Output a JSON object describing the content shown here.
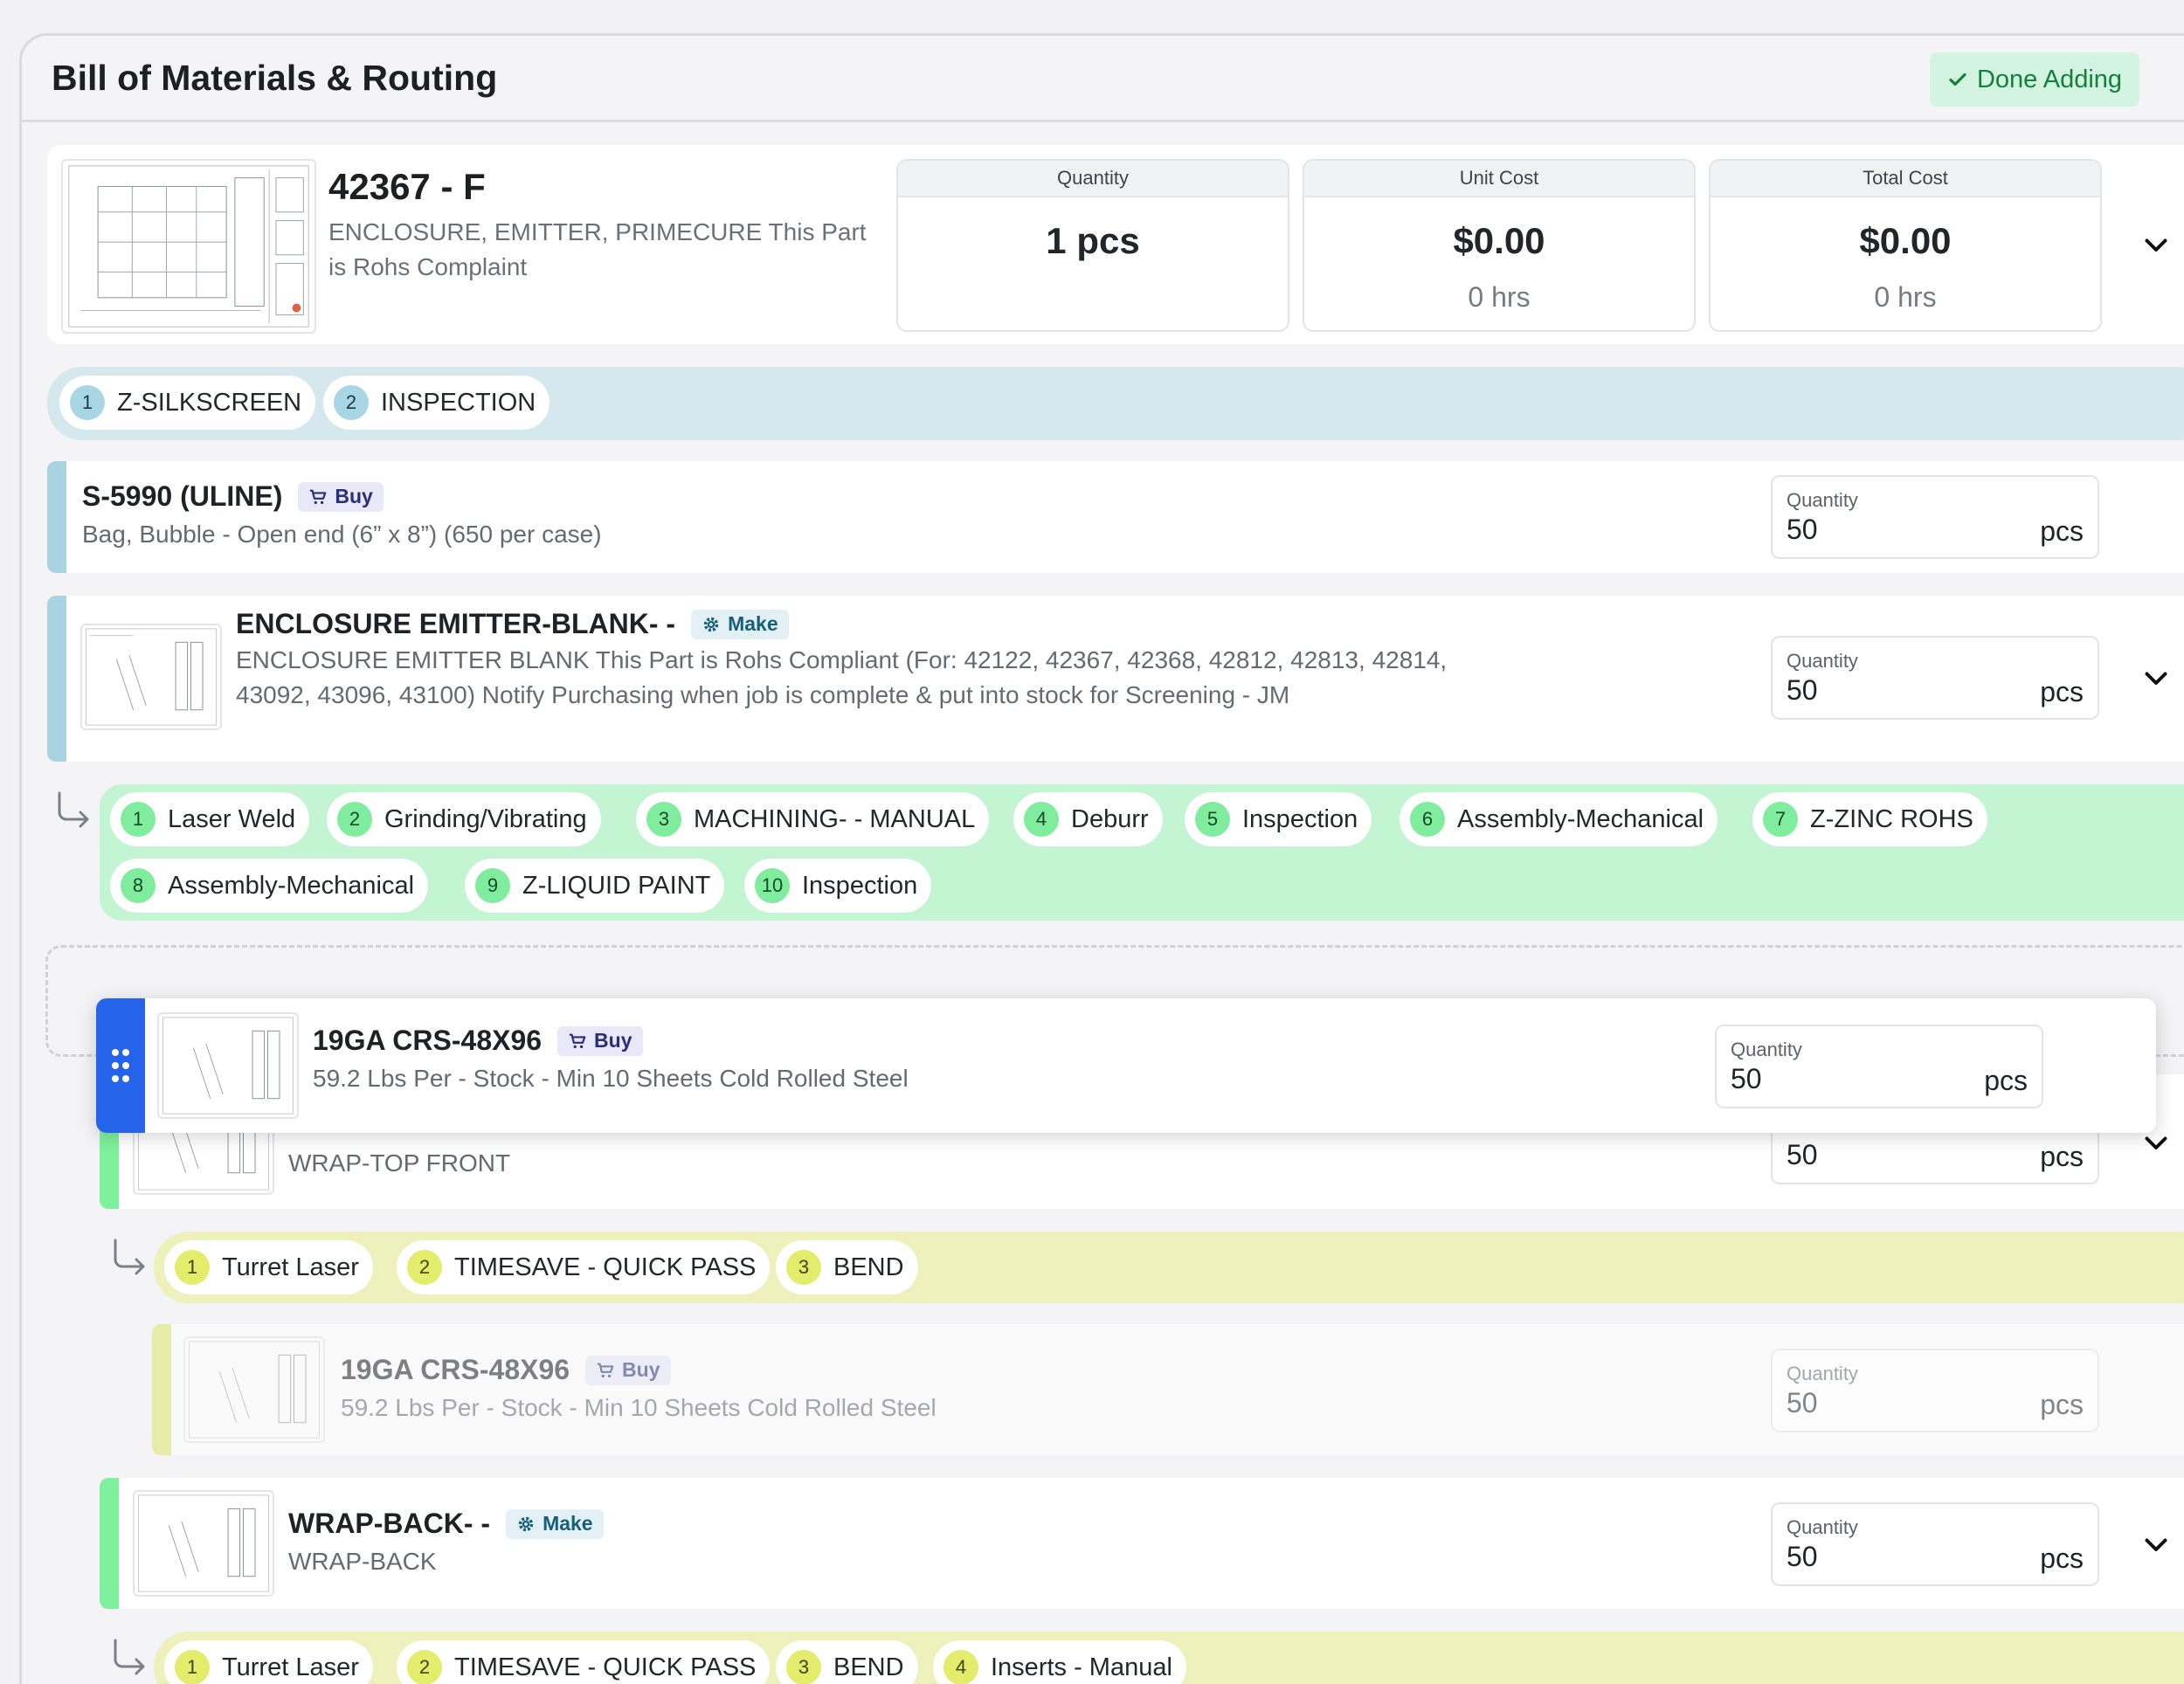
{
  "header": {
    "title": "Bill of Materials & Routing",
    "done_label": "Done Adding"
  },
  "part": {
    "number": "42367 - F",
    "description": "ENCLOSURE, EMITTER, PRIMECURE This Part is Rohs Complaint",
    "quantity_label": "Quantity",
    "quantity_value": "1 pcs",
    "unit_cost_label": "Unit Cost",
    "unit_cost_value": "$0.00",
    "unit_cost_hours": "0 hrs",
    "total_cost_label": "Total Cost",
    "total_cost_value": "$0.00",
    "total_cost_hours": "0 hrs"
  },
  "top_routing": [
    {
      "num": "1",
      "label": "Z-SILKSCREEN"
    },
    {
      "num": "2",
      "label": "INSPECTION"
    }
  ],
  "items": {
    "s5990": {
      "title": "S-5990 (ULINE)",
      "badge": "Buy",
      "desc": "Bag, Bubble - Open end (6” x 8”) (650 per case)",
      "qty_label": "Quantity",
      "qty": "50",
      "unit": "pcs"
    },
    "blank": {
      "title": "ENCLOSURE EMITTER-BLANK- -",
      "badge": "Make",
      "desc": "ENCLOSURE EMITTER BLANK This Part is Rohs Compliant (For: 42122, 42367, 42368, 42812, 42813, 42814, 43092, 43096, 43100) Notify Purchasing when job is complete & put into stock for Screening - JM",
      "qty_label": "Quantity",
      "qty": "50",
      "unit": "pcs"
    },
    "dragging": {
      "title": "19GA CRS-48X96",
      "badge": "Buy",
      "desc": "59.2 Lbs Per - Stock - Min 10 Sheets Cold Rolled Steel",
      "qty_label": "Quantity",
      "qty": "50",
      "unit": "pcs"
    },
    "wraptop": {
      "desc": "WRAP-TOP FRONT",
      "qty": "50",
      "unit": "pcs"
    },
    "crs_nested": {
      "title": "19GA CRS-48X96",
      "badge": "Buy",
      "desc": "59.2 Lbs Per - Stock - Min 10 Sheets Cold Rolled Steel",
      "qty_label": "Quantity",
      "qty": "50",
      "unit": "pcs"
    },
    "wrapback": {
      "title": "WRAP-BACK- -",
      "badge": "Make",
      "desc": "WRAP-BACK",
      "qty_label": "Quantity",
      "qty": "50",
      "unit": "pcs"
    }
  },
  "blank_routing": [
    {
      "num": "1",
      "label": "Laser Weld"
    },
    {
      "num": "2",
      "label": "Grinding/Vibrating"
    },
    {
      "num": "3",
      "label": "MACHINING- - MANUAL"
    },
    {
      "num": "4",
      "label": "Deburr"
    },
    {
      "num": "5",
      "label": "Inspection"
    },
    {
      "num": "6",
      "label": "Assembly-Mechanical"
    },
    {
      "num": "7",
      "label": "Z-ZINC ROHS"
    },
    {
      "num": "8",
      "label": "Assembly-Mechanical"
    },
    {
      "num": "9",
      "label": "Z-LIQUID PAINT"
    },
    {
      "num": "10",
      "label": "Inspection"
    }
  ],
  "wraptop_routing": [
    {
      "num": "1",
      "label": "Turret Laser"
    },
    {
      "num": "2",
      "label": "TIMESAVE - QUICK PASS"
    },
    {
      "num": "3",
      "label": "BEND"
    }
  ],
  "wrapback_routing": [
    {
      "num": "1",
      "label": "Turret Laser"
    },
    {
      "num": "2",
      "label": "TIMESAVE - QUICK PASS"
    },
    {
      "num": "3",
      "label": "BEND"
    },
    {
      "num": "4",
      "label": "Inserts - Manual"
    }
  ],
  "colors": {
    "blue_strip": "#d4e8ee",
    "green_strip": "#c3f5d3",
    "yellow_strip": "#eef1bc",
    "drag_handle": "#2563eb",
    "done_text": "#14803c"
  },
  "icons": {
    "check": "check-icon",
    "cart": "cart-icon",
    "gear": "gear-icon",
    "chevron": "chevron-down-icon",
    "arrow": "corner-down-right-icon",
    "grip": "grip-vertical-icon"
  }
}
